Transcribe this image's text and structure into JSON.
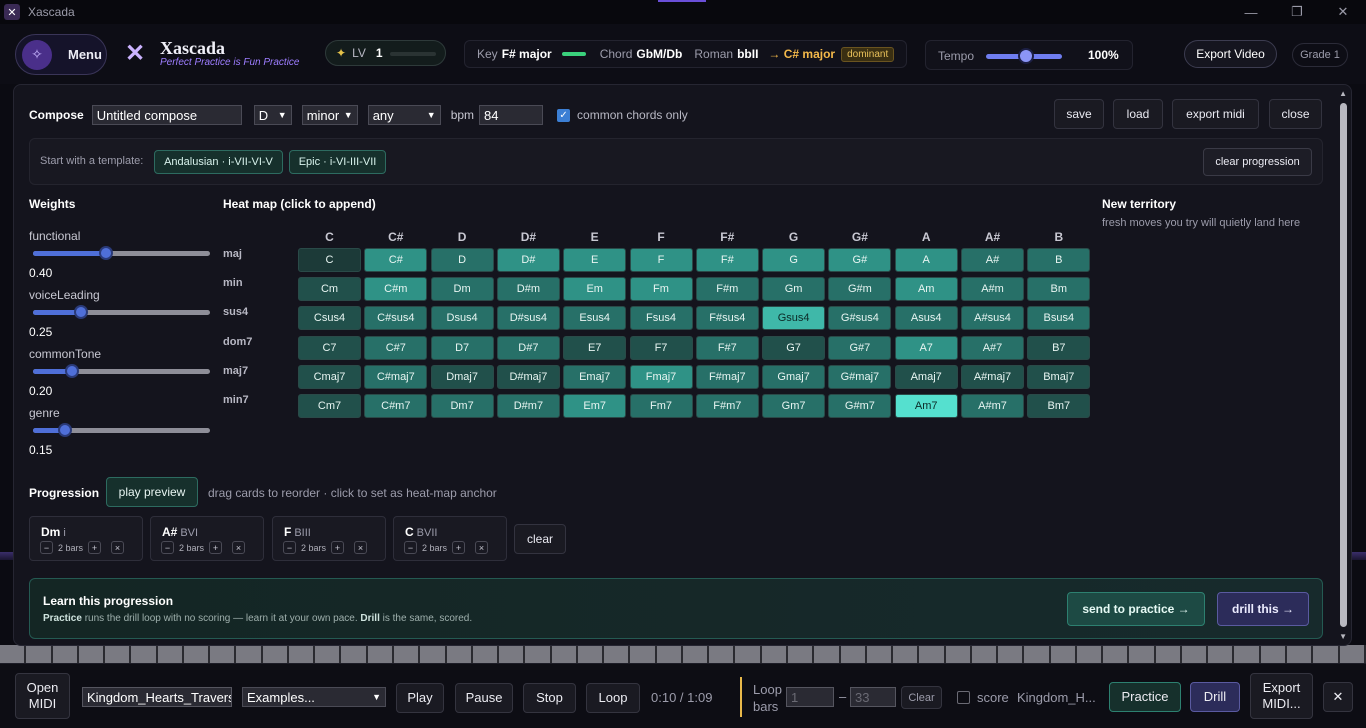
{
  "window": {
    "title": "Xascada",
    "app_icon": "✕",
    "minimize": "—",
    "restore": "❐",
    "close": "✕"
  },
  "header": {
    "menu_label": "Menu",
    "logo_glyph": "✕",
    "brand": "Xascada",
    "tagline": "Perfect Practice is Fun Practice",
    "level_label": "LV",
    "level_value": "1",
    "star": "✦",
    "key_label": "Key",
    "key_value": "F# major",
    "chord_label": "Chord",
    "chord_value": "GbM/Db",
    "roman_label": "Roman",
    "roman_value": "bbII",
    "target": "→ C# major",
    "target_badge": "dominant",
    "tempo_label": "Tempo",
    "tempo_value": "100%",
    "export_video": "Export Video",
    "grade": "Grade 1"
  },
  "compose": {
    "label": "Compose",
    "name_value": "Untitled compose",
    "key_select": "D",
    "mode_select": "minor",
    "style_select": "any",
    "bpm_label": "bpm",
    "bpm_value": "84",
    "common_label": "common chords only",
    "buttons": {
      "save": "save",
      "load": "load",
      "export_midi": "export midi",
      "close": "close"
    }
  },
  "templates": {
    "label": "Start with a template:",
    "items": [
      "Andalusian · i-VII-VI-V",
      "Epic · i-VI-III-VII"
    ],
    "clear": "clear progression"
  },
  "weights": {
    "title": "Weights",
    "items": [
      {
        "label": "functional",
        "value": "0.40"
      },
      {
        "label": "voiceLeading",
        "value": "0.25"
      },
      {
        "label": "commonTone",
        "value": "0.20"
      },
      {
        "label": "genre",
        "value": "0.15"
      }
    ]
  },
  "heatmap": {
    "title": "Heat map (click to append)",
    "columns": [
      "C",
      "C#",
      "D",
      "D#",
      "E",
      "F",
      "F#",
      "G",
      "G#",
      "A",
      "A#",
      "B"
    ],
    "rows": [
      {
        "label": "maj",
        "cells": [
          "C",
          "C#",
          "D",
          "D#",
          "E",
          "F",
          "F#",
          "G",
          "G#",
          "A",
          "A#",
          "B"
        ]
      },
      {
        "label": "min",
        "cells": [
          "Cm",
          "C#m",
          "Dm",
          "D#m",
          "Em",
          "Fm",
          "F#m",
          "Gm",
          "G#m",
          "Am",
          "A#m",
          "Bm"
        ]
      },
      {
        "label": "sus4",
        "cells": [
          "Csus4",
          "C#sus4",
          "Dsus4",
          "D#sus4",
          "Esus4",
          "Fsus4",
          "F#sus4",
          "Gsus4",
          "G#sus4",
          "Asus4",
          "A#sus4",
          "Bsus4"
        ]
      },
      {
        "label": "dom7",
        "cells": [
          "C7",
          "C#7",
          "D7",
          "D#7",
          "E7",
          "F7",
          "F#7",
          "G7",
          "G#7",
          "A7",
          "A#7",
          "B7"
        ]
      },
      {
        "label": "maj7",
        "cells": [
          "Cmaj7",
          "C#maj7",
          "Dmaj7",
          "D#maj7",
          "Emaj7",
          "Fmaj7",
          "F#maj7",
          "Gmaj7",
          "G#maj7",
          "Amaj7",
          "A#maj7",
          "Bmaj7"
        ]
      },
      {
        "label": "min7",
        "cells": [
          "Cm7",
          "C#m7",
          "Dm7",
          "D#m7",
          "Em7",
          "Fm7",
          "F#m7",
          "Gm7",
          "G#m7",
          "Am7",
          "A#m7",
          "Bm7"
        ]
      }
    ]
  },
  "new_territory": {
    "title": "New territory",
    "subtitle": "fresh moves you try will quietly land here"
  },
  "progression": {
    "title": "Progression",
    "play_preview": "play preview",
    "hint": "drag cards to reorder · click to set as heat-map anchor",
    "cards": [
      {
        "chord": "Dm",
        "roman": "i",
        "bars": "2 bars"
      },
      {
        "chord": "A#",
        "roman": "BVI",
        "bars": "2 bars"
      },
      {
        "chord": "F",
        "roman": "BIII",
        "bars": "2 bars"
      },
      {
        "chord": "C",
        "roman": "BVII",
        "bars": "2 bars"
      }
    ],
    "clear": "clear"
  },
  "learn": {
    "title": "Learn this progression",
    "desc_practice": "Practice",
    "desc_mid": " runs the drill loop with no scoring — learn it at your own pace. ",
    "desc_drill": "Drill",
    "desc_end": " is the same, scored.",
    "send": "send to practice →",
    "drill": "drill this →"
  },
  "bottom": {
    "open_midi": "Open MIDI",
    "file_value": "Kingdom_Hearts_Traverse",
    "examples": "Examples...",
    "play": "Play",
    "pause": "Pause",
    "stop": "Stop",
    "loop": "Loop",
    "time": "0:10 / 1:09",
    "loop_bars": "Loop bars",
    "loop_from_placeholder": "1",
    "loop_dash": "–",
    "loop_to_placeholder": "33",
    "clear": "Clear",
    "score": "score",
    "song": "Kingdom_H...",
    "practice": "Practice",
    "drill": "Drill",
    "export_midi": "Export MIDI...",
    "close": "✕"
  },
  "colors": {
    "accent_purple": "#9d7dff",
    "accent_teal": "#2d8070",
    "key_green": "#3ad17c",
    "dominant": "#e8c05a"
  }
}
